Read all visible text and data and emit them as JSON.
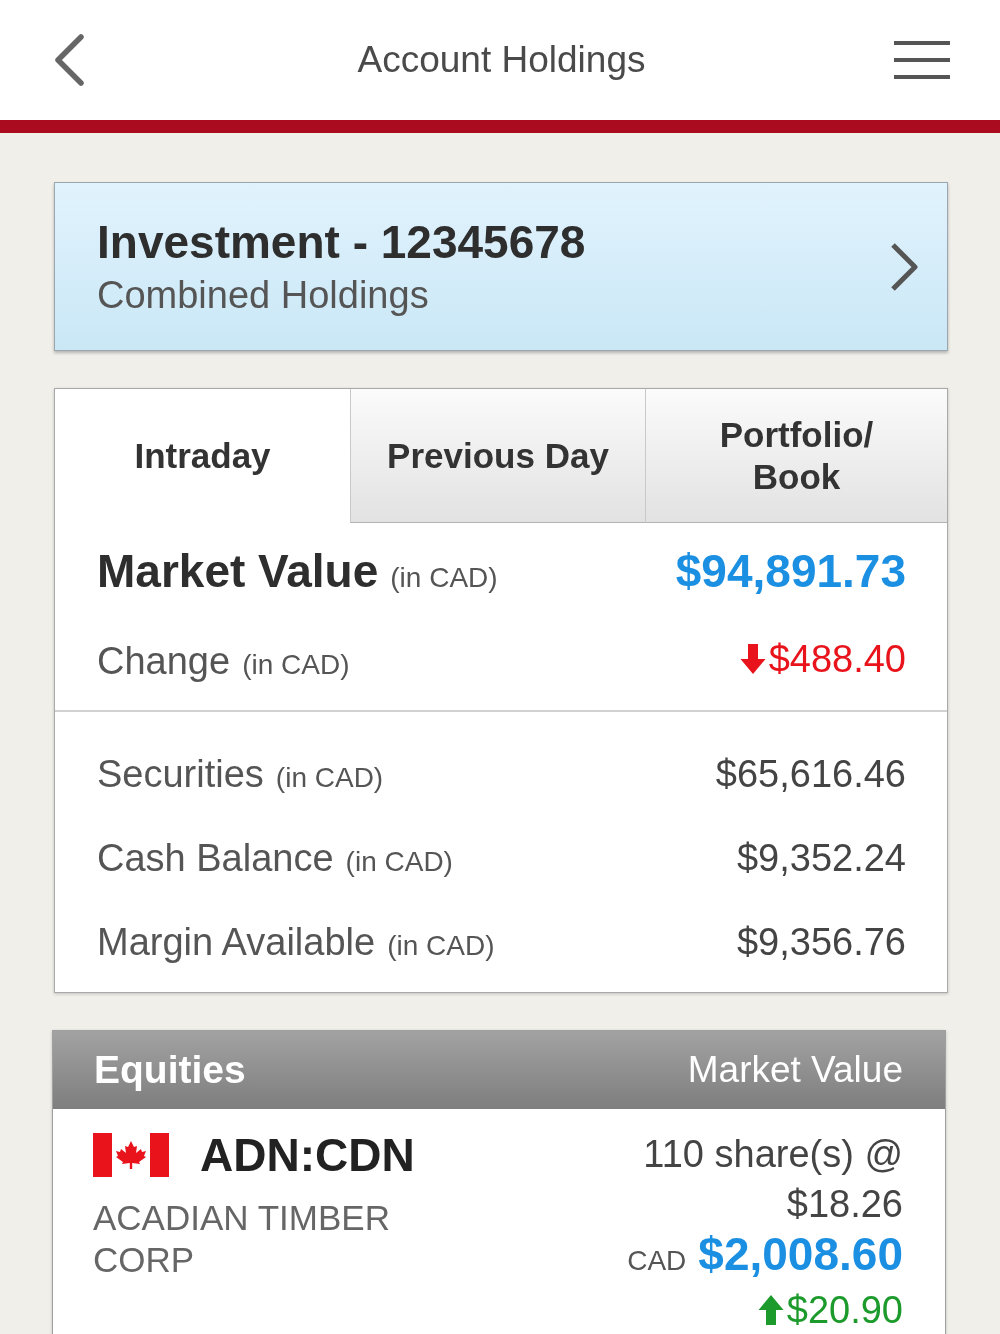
{
  "header": {
    "title": "Account Holdings"
  },
  "account": {
    "title": "Investment - 12345678",
    "subtitle": "Combined Holdings"
  },
  "tabs": [
    {
      "label": "Intraday",
      "selected": true
    },
    {
      "label": "Previous Day",
      "selected": false
    },
    {
      "label": "Portfolio/\nBook",
      "selected": false
    }
  ],
  "summary": {
    "market_value": {
      "label": "Market Value",
      "unit": "(in CAD)",
      "value": "$94,891.73"
    },
    "change": {
      "label": "Change",
      "unit": "(in CAD)",
      "value": "$488.40",
      "negative": true
    },
    "balances": [
      {
        "label": "Securities",
        "unit": "(in CAD)",
        "value": "$65,616.46"
      },
      {
        "label": "Cash Balance",
        "unit": "(in CAD)",
        "value": "$9,352.24"
      },
      {
        "label": "Margin Available",
        "unit": "(in CAD)",
        "value": "$9,356.76"
      }
    ]
  },
  "equities": {
    "title": "Equities",
    "column_heading": "Market Value",
    "holdings": [
      {
        "symbol": "ADN:CDN",
        "name": "ACADIAN TIMBER CORP",
        "quantity": "110 share(s) @",
        "price": "$18.26",
        "currency": "CAD",
        "market_value": "$2,008.60",
        "change": "$20.90",
        "negative": false
      }
    ]
  }
}
